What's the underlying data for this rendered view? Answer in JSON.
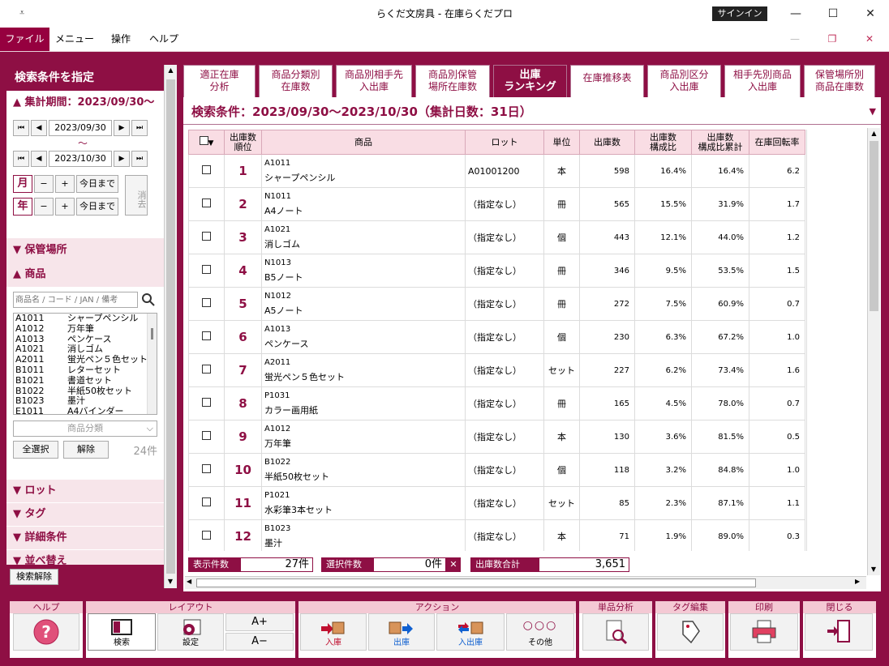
{
  "window": {
    "title": "らくだ文房具 - 在庫らくだプロ",
    "signin": "サインイン",
    "minimize": "—",
    "maximize": "☐",
    "close": "✕",
    "inner_min": "—",
    "inner_restore": "❐",
    "inner_close": "✕"
  },
  "menu": {
    "file": "ファイル",
    "menu": "メニュー",
    "ops": "操作",
    "help": "ヘルプ"
  },
  "left": {
    "header": "検索条件を指定",
    "period_label": "集計期間：2023/09/30〜",
    "date_from": "2023/09/30",
    "tilde": "〜",
    "date_to": "2023/10/30",
    "month": "月",
    "year": "年",
    "minus": "−",
    "plus": "+",
    "today": "今日まで",
    "clear": "消去",
    "storage": "保管場所",
    "product": "商品",
    "search_placeholder": "商品名 / コード / JAN / 備考",
    "products": [
      {
        "code": "A1011",
        "name": "シャープペンシル"
      },
      {
        "code": "A1012",
        "name": "万年筆"
      },
      {
        "code": "A1013",
        "name": "ペンケース"
      },
      {
        "code": "A1021",
        "name": "消しゴム"
      },
      {
        "code": "A2011",
        "name": "蛍光ペン５色セット"
      },
      {
        "code": "B1011",
        "name": "レターセット"
      },
      {
        "code": "B1021",
        "name": "書道セット"
      },
      {
        "code": "B1022",
        "name": "半紙50枚セット"
      },
      {
        "code": "B1023",
        "name": "墨汁"
      },
      {
        "code": "E1011",
        "name": "A4バインダー"
      }
    ],
    "category_placeholder": "商品分類",
    "select_all": "全選択",
    "deselect": "解除",
    "count": "24件",
    "lot": "ロット",
    "tag": "タグ",
    "detail": "詳細条件",
    "sort": "並べ替え",
    "search_clear": "検索解除"
  },
  "tabs": [
    {
      "l1": "適正在庫",
      "l2": "分析"
    },
    {
      "l1": "商品分類別",
      "l2": "在庫数"
    },
    {
      "l1": "商品別相手先",
      "l2": "入出庫"
    },
    {
      "l1": "商品別保管",
      "l2": "場所在庫数"
    },
    {
      "l1": "出庫",
      "l2": "ランキング"
    },
    {
      "l1": "在庫推移表",
      "l2": ""
    },
    {
      "l1": "商品別区分",
      "l2": "入出庫"
    },
    {
      "l1": "相手先別商品",
      "l2": "入出庫"
    },
    {
      "l1": "保管場所別",
      "l2": "商品在庫数"
    }
  ],
  "condition": "検索条件：2023/09/30〜2023/10/30（集計日数：31日）",
  "columns": {
    "rank_l1": "出庫数",
    "rank_l2": "順位",
    "product": "商品",
    "lot": "ロット",
    "unit": "単位",
    "qty": "出庫数",
    "ratio_l1": "出庫数",
    "ratio_l2": "構成比",
    "cum_l1": "出庫数",
    "cum_l2": "構成比累計",
    "turnover": "在庫回転率"
  },
  "rows": [
    {
      "rank": "1",
      "code": "A1011",
      "name": "シャープペンシル",
      "lot": "A01001200",
      "unit": "本",
      "qty": "598",
      "ratio": "16.4%",
      "cum": "16.4%",
      "turn": "6.2"
    },
    {
      "rank": "2",
      "code": "N1011",
      "name": "A4ノート",
      "lot": "（指定なし）",
      "unit": "冊",
      "qty": "565",
      "ratio": "15.5%",
      "cum": "31.9%",
      "turn": "1.7"
    },
    {
      "rank": "3",
      "code": "A1021",
      "name": "消しゴム",
      "lot": "（指定なし）",
      "unit": "個",
      "qty": "443",
      "ratio": "12.1%",
      "cum": "44.0%",
      "turn": "1.2"
    },
    {
      "rank": "4",
      "code": "N1013",
      "name": "B5ノート",
      "lot": "（指定なし）",
      "unit": "冊",
      "qty": "346",
      "ratio": "9.5%",
      "cum": "53.5%",
      "turn": "1.5"
    },
    {
      "rank": "5",
      "code": "N1012",
      "name": "A5ノート",
      "lot": "（指定なし）",
      "unit": "冊",
      "qty": "272",
      "ratio": "7.5%",
      "cum": "60.9%",
      "turn": "0.7"
    },
    {
      "rank": "6",
      "code": "A1013",
      "name": "ペンケース",
      "lot": "（指定なし）",
      "unit": "個",
      "qty": "230",
      "ratio": "6.3%",
      "cum": "67.2%",
      "turn": "1.0"
    },
    {
      "rank": "7",
      "code": "A2011",
      "name": "蛍光ペン５色セット",
      "lot": "（指定なし）",
      "unit": "セット",
      "qty": "227",
      "ratio": "6.2%",
      "cum": "73.4%",
      "turn": "1.6"
    },
    {
      "rank": "8",
      "code": "P1031",
      "name": "カラー画用紙",
      "lot": "（指定なし）",
      "unit": "冊",
      "qty": "165",
      "ratio": "4.5%",
      "cum": "78.0%",
      "turn": "0.7"
    },
    {
      "rank": "9",
      "code": "A1012",
      "name": "万年筆",
      "lot": "（指定なし）",
      "unit": "本",
      "qty": "130",
      "ratio": "3.6%",
      "cum": "81.5%",
      "turn": "0.5"
    },
    {
      "rank": "10",
      "code": "B1022",
      "name": "半紙50枚セット",
      "lot": "（指定なし）",
      "unit": "個",
      "qty": "118",
      "ratio": "3.2%",
      "cum": "84.8%",
      "turn": "1.0"
    },
    {
      "rank": "11",
      "code": "P1021",
      "name": "水彩筆3本セット",
      "lot": "（指定なし）",
      "unit": "セット",
      "qty": "85",
      "ratio": "2.3%",
      "cum": "87.1%",
      "turn": "1.1"
    },
    {
      "rank": "12",
      "code": "B1023",
      "name": "墨汁",
      "lot": "（指定なし）",
      "unit": "本",
      "qty": "71",
      "ratio": "1.9%",
      "cum": "89.0%",
      "turn": "0.3"
    }
  ],
  "status": {
    "shown_label": "表示件数",
    "shown": "27件",
    "selected_label": "選択件数",
    "selected": "0件",
    "total_label": "出庫数合計",
    "total": "3,651"
  },
  "toolbar": {
    "help_group": "ヘルプ",
    "layout_group": "レイアウト",
    "action_group": "アクション",
    "analysis_group": "単品分析",
    "tag_group": "タグ編集",
    "print_group": "印刷",
    "close_group": "閉じる",
    "search": "検索",
    "settings": "設定",
    "font_up": "A+",
    "font_down": "A−",
    "in": "入庫",
    "out": "出庫",
    "inout": "入出庫",
    "other": "その他"
  }
}
